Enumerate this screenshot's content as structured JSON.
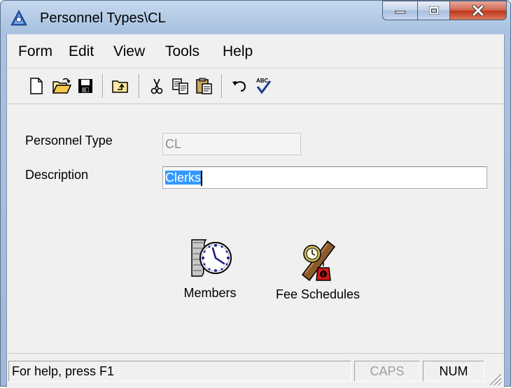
{
  "window": {
    "title": "Personnel Types\\CL",
    "icons": {
      "app": "app-icon",
      "minimize": "minimize-icon",
      "maximize": "maximize-icon",
      "close": "close-icon"
    }
  },
  "menu": {
    "items": [
      {
        "label": "Form"
      },
      {
        "label": "Edit"
      },
      {
        "label": "View"
      },
      {
        "label": "Tools"
      },
      {
        "label": "Help"
      }
    ]
  },
  "toolbar": {
    "buttons": [
      "new-document-icon",
      "open-folder-icon",
      "save-disk-icon",
      "up-folder-icon",
      "cut-scissors-icon",
      "copy-icon",
      "paste-icon",
      "undo-icon",
      "spell-check-icon"
    ]
  },
  "form": {
    "personnel_type_label": "Personnel Type",
    "personnel_type_value": "CL",
    "description_label": "Description",
    "description_value": "Clerks"
  },
  "actions": {
    "members_label": "Members",
    "fee_schedules_label": "Fee Schedules"
  },
  "status": {
    "help_text": "For help, press F1",
    "caps": "CAPS",
    "num": "NUM"
  }
}
